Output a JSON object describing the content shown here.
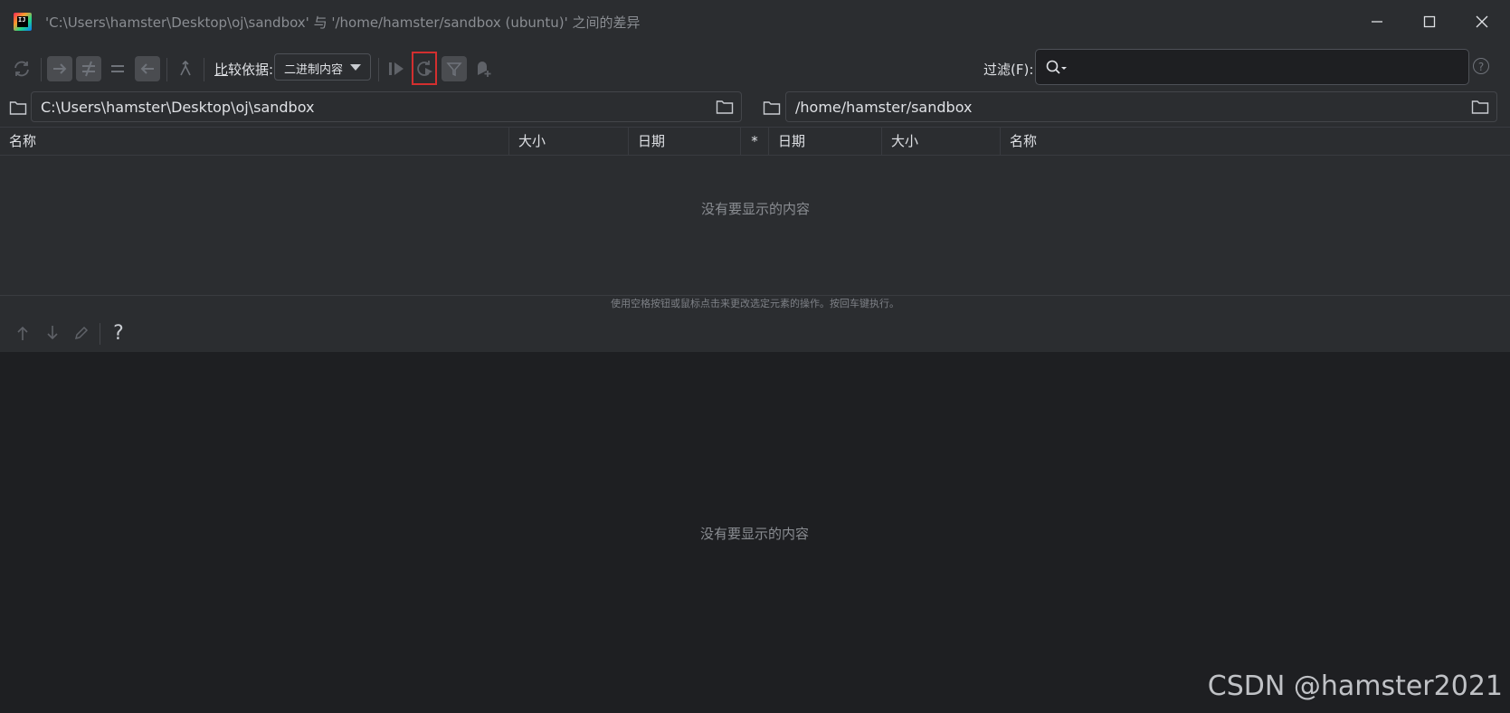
{
  "window": {
    "title": "'C:\\Users\\hamster\\Desktop\\oj\\sandbox' 与 '/home/hamster/sandbox (ubuntu)' 之间的差异",
    "app_icon_text": "IJ"
  },
  "toolbar": {
    "compare_label_mnemonic": "比",
    "compare_label_rest": "较依据:",
    "compare_by_value": "二进制内容",
    "filter_label": "过滤(F):",
    "filter_placeholder": "",
    "help_glyph": "?"
  },
  "paths": {
    "left": "C:\\Users\\hamster\\Desktop\\oj\\sandbox",
    "right": "/home/hamster/sandbox"
  },
  "table": {
    "columns": {
      "left_name": "名称",
      "left_size": "大小",
      "left_date": "日期",
      "diff": "*",
      "right_date": "日期",
      "right_size": "大小",
      "right_name": "名称"
    },
    "empty_text": "没有要显示的内容"
  },
  "hint": "使用空格按钮或鼠标点击来更改选定元素的操作。按回车键执行。",
  "bottom_toolbar": {
    "help_glyph": "?"
  },
  "diff_panel": {
    "empty_text": "没有要显示的内容"
  },
  "watermark": "CSDN @hamster2021",
  "colors": {
    "background": "#1e1f22",
    "panel": "#2b2d30",
    "highlight": "#d32f2f"
  }
}
